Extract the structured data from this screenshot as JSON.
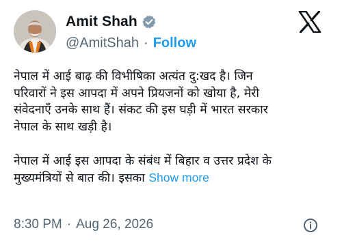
{
  "author": {
    "display_name": "Amit Shah",
    "handle": "@AmitShah",
    "separator": "·",
    "follow_label": "Follow",
    "verified_icon": "verified-badge-icon"
  },
  "platform_logo": "x-logo-icon",
  "tweet": {
    "paragraphs": [
      {
        "lines": [
          "नेपाल में आई बाढ़ की विभीषिका अत्यंत दु:खद है। जिन",
          "परिवारों ने इस आपदा में अपने प्रियजनों को खोया है, मेरी",
          "संवेदनाएँ उनके साथ हैं। संकट की इस घड़ी में भारत सरकार",
          "नेपाल के साथ खड़ी है।"
        ]
      },
      {
        "lines": [
          "नेपाल में आई इस आपदा के संबंध में बिहार व उत्तर प्रदेश के",
          "मुख्यमंत्रियों से बात की। इसका"
        ],
        "show_more": "Show more"
      }
    ]
  },
  "meta": {
    "time": "8:30 PM",
    "separator": "·",
    "date": "Aug 26, 2026",
    "info_icon": "info-icon"
  },
  "colors": {
    "accent": "#1d9bf0",
    "text": "#0f1419",
    "muted": "#536471"
  }
}
